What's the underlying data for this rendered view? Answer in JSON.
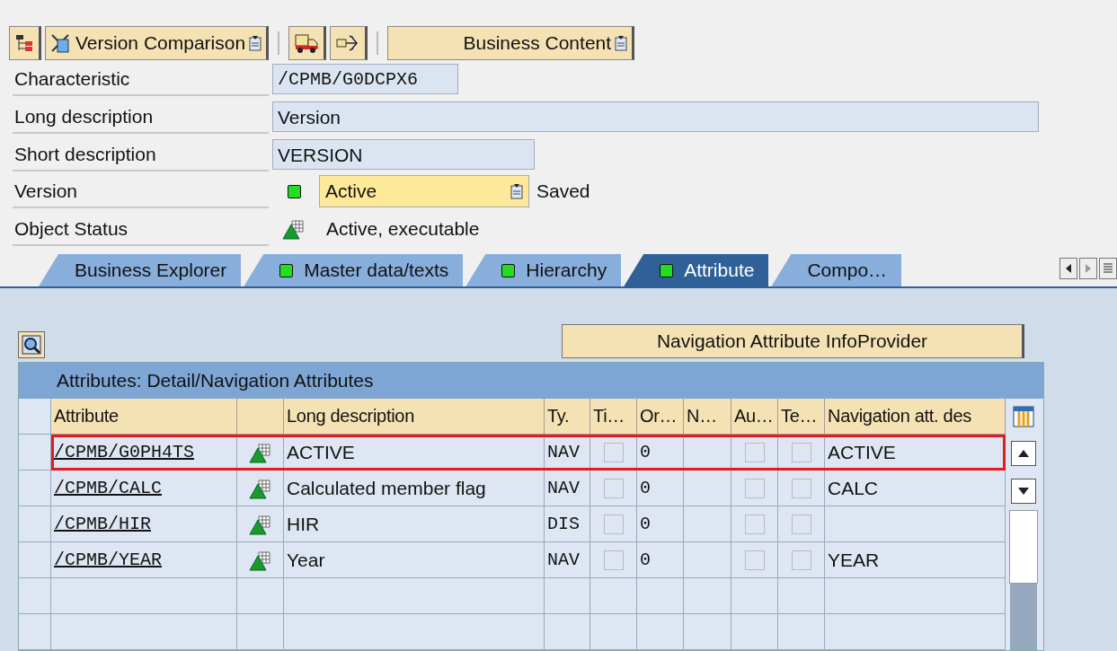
{
  "toolbar": {
    "version_comparison": "Version Comparison",
    "business_content": "Business Content"
  },
  "fields": [
    {
      "label": "Characteristic",
      "value": "/CPMB/G0DCPX6",
      "kind": "mono"
    },
    {
      "label": "Long description",
      "value": "Version",
      "kind": "long"
    },
    {
      "label": "Short description",
      "value": "VERSION",
      "kind": "short"
    }
  ],
  "version": {
    "label": "Version",
    "value": "Active",
    "status": "Saved",
    "status_light": true
  },
  "object_status": {
    "label": "Object Status",
    "value": "Active, executable"
  },
  "tabs": [
    {
      "label": "Business Explorer",
      "status_light": false,
      "selected": false
    },
    {
      "label": "Master data/texts",
      "status_light": true,
      "selected": false
    },
    {
      "label": "Hierarchy",
      "status_light": true,
      "selected": false
    },
    {
      "label": "Attribute",
      "status_light": true,
      "selected": true
    },
    {
      "label": "Compo…",
      "status_light": false,
      "selected": false
    }
  ],
  "nav_button": "Navigation Attribute InfoProvider",
  "table": {
    "title": "Attributes: Detail/Navigation Attributes",
    "columns": [
      "Attribute",
      "Long description",
      "Ty.",
      "Ti…",
      "Or…",
      "N…",
      "Au…",
      "Te…",
      "Navigation att. des"
    ],
    "rows": [
      {
        "attribute": "/CPMB/G0PH4TS",
        "description": "ACTIVE",
        "type": "NAV",
        "ti": false,
        "order": "0",
        "au": false,
        "te": false,
        "nav": "ACTIVE",
        "highlighted": true
      },
      {
        "attribute": "/CPMB/CALC",
        "description": "Calculated member flag",
        "type": "NAV",
        "ti": false,
        "order": "0",
        "au": false,
        "te": false,
        "nav": "CALC",
        "highlighted": false
      },
      {
        "attribute": "/CPMB/HIR",
        "description": "HIR",
        "type": "DIS",
        "ti": false,
        "order": "0",
        "au": false,
        "te": false,
        "highlighted": false
      },
      {
        "attribute": "/CPMB/YEAR",
        "description": "Year",
        "type": "NAV",
        "ti": false,
        "order": "0",
        "au": false,
        "te": false,
        "nav": "YEAR",
        "highlighted": false
      }
    ]
  }
}
